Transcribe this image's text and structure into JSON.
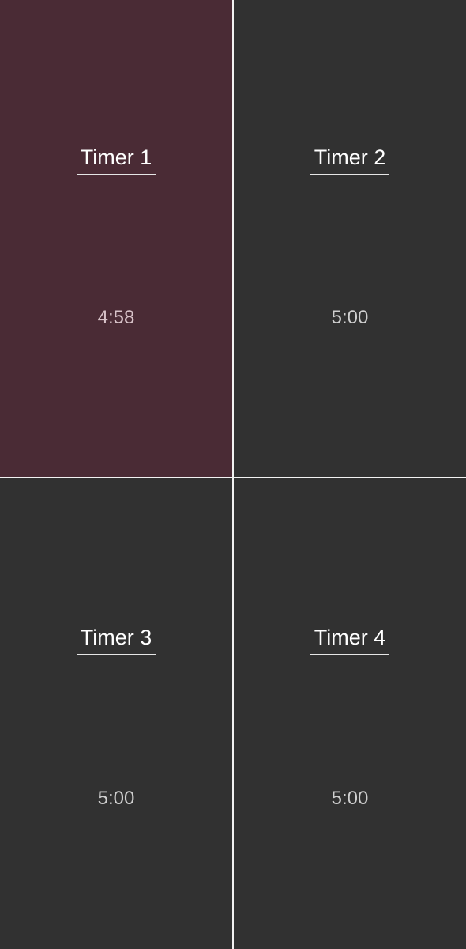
{
  "timers": [
    {
      "name": "Timer 1",
      "time": "4:58",
      "state": "running",
      "background": "#4a2b35",
      "time_color": "#d8c3c9"
    },
    {
      "name": "Timer 2",
      "time": "5:00",
      "state": "idle",
      "background": "#313131",
      "time_color": "#cfcfcf"
    },
    {
      "name": "Timer 3",
      "time": "5:00",
      "state": "idle",
      "background": "#313131",
      "time_color": "#cfcfcf"
    },
    {
      "name": "Timer 4",
      "time": "5:00",
      "state": "idle",
      "background": "#313131",
      "time_color": "#cfcfcf"
    }
  ],
  "colors": {
    "divider": "#f2f2f2",
    "name_text": "#ffffff",
    "underline": "#e6e6e6"
  }
}
